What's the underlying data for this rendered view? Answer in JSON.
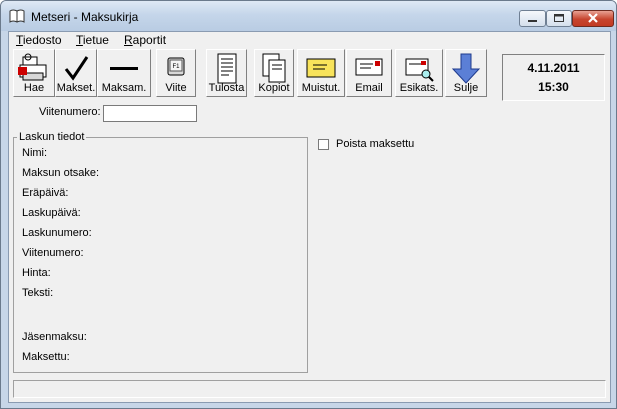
{
  "window": {
    "title": "Metseri - Maksukirja"
  },
  "menu": [
    {
      "label": "Tiedosto"
    },
    {
      "label": "Tietue"
    },
    {
      "label": "Raportit"
    }
  ],
  "toolbar": {
    "buttons": [
      {
        "label": "Hae",
        "icon": "search-printer-icon"
      },
      {
        "label": "Makset.",
        "icon": "checkmark-icon"
      },
      {
        "label": "Maksam.",
        "icon": "dash-icon"
      },
      {
        "label": "Viite",
        "icon": "key-icon"
      },
      {
        "label": "Tulosta",
        "icon": "document-icon"
      },
      {
        "label": "Kopiot",
        "icon": "copies-icon"
      },
      {
        "label": "Muistut.",
        "icon": "envelope-icon"
      },
      {
        "label": "Email",
        "icon": "email-icon"
      },
      {
        "label": "Esikats.",
        "icon": "preview-icon"
      },
      {
        "label": "Sulje",
        "icon": "down-arrow-icon"
      }
    ]
  },
  "clock": {
    "date": "4.11.2011",
    "time": "15:30"
  },
  "search": {
    "label": "Viitenumero:",
    "value": ""
  },
  "details": {
    "title": "Laskun tiedot",
    "fields": [
      {
        "label": "Nimi:"
      },
      {
        "label": "Maksun otsake:"
      },
      {
        "label": "Eräpäivä:"
      },
      {
        "label": "Laskupäivä:"
      },
      {
        "label": "Laskunumero:"
      },
      {
        "label": "Viitenumero:"
      },
      {
        "label": "Hinta:"
      },
      {
        "label": "Teksti:"
      },
      {
        "label": "Jäsenmaksu:"
      },
      {
        "label": "Maksettu:"
      }
    ]
  },
  "options": {
    "remove_paid_label": "Poista maksettu",
    "remove_paid_checked": false
  },
  "statusbar": {
    "text": ""
  }
}
